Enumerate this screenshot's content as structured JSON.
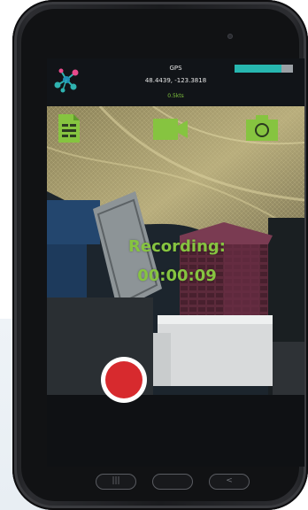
{
  "status": {
    "gps_label": "GPS",
    "coordinates": "48.4439, -123.3818",
    "speed": "0.5kts",
    "battery_level": 0.8,
    "battery_color": "#27b7b0"
  },
  "app": {
    "logo_icon": "molecule-logo-icon",
    "accent_color": "#86c440"
  },
  "toolbar": {
    "icons": [
      "document-icon",
      "video-camera-icon",
      "photo-camera-icon"
    ]
  },
  "recording": {
    "label": "Recording:",
    "elapsed": "00:00:09",
    "record_button_color": "#d72a2e"
  },
  "navigation": {
    "keys": [
      "recent-apps-icon",
      "home-icon",
      "back-icon"
    ]
  }
}
